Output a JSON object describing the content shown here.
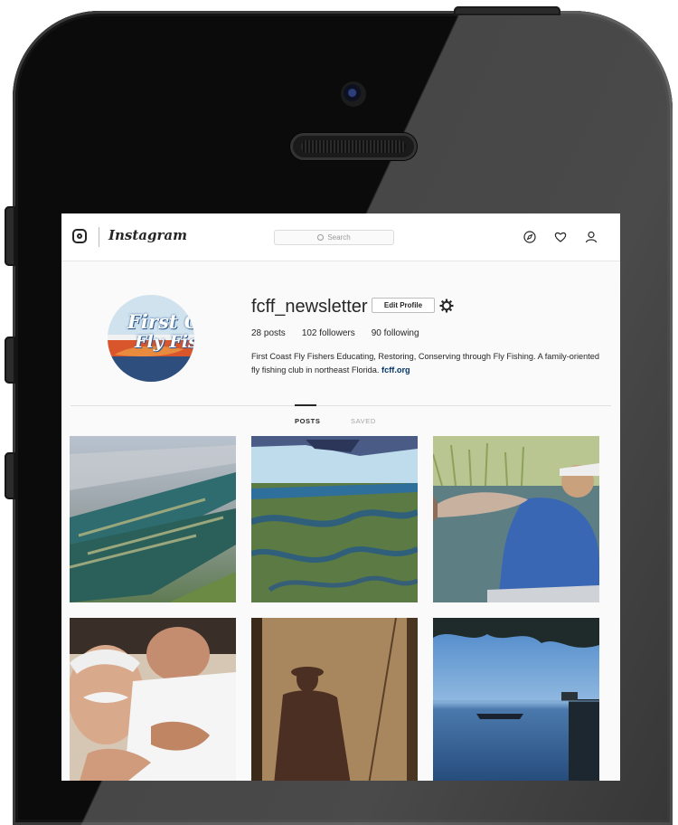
{
  "header": {
    "wordmark": "Instagram",
    "search_placeholder": "Search"
  },
  "profile": {
    "username": "fcff_newsletter",
    "edit_profile_label": "Edit Profile",
    "avatar_text_line1": "First C",
    "avatar_text_line2": "Fly Fis",
    "stats": {
      "posts": "28 posts",
      "followers": "102 followers",
      "following": "90 following"
    },
    "bio": "First Coast Fly Fishers Educating, Restoring, Conserving through Fly Fishing. A family-oriented fly fishing club in northeast Florida.",
    "bio_link": "fcff.org"
  },
  "tabs": [
    {
      "label": "POSTS",
      "active": true
    },
    {
      "label": "SAVED",
      "active": false
    }
  ],
  "posts": [
    {
      "subject": "aerial-coast-1"
    },
    {
      "subject": "aerial-marsh-wing"
    },
    {
      "subject": "angler-redfish"
    },
    {
      "subject": "fly-tying-men"
    },
    {
      "subject": "angler-shadow"
    },
    {
      "subject": "lake-dock"
    }
  ],
  "colors": {
    "text": "#262626",
    "link": "#003569",
    "background": "#fafafa"
  }
}
